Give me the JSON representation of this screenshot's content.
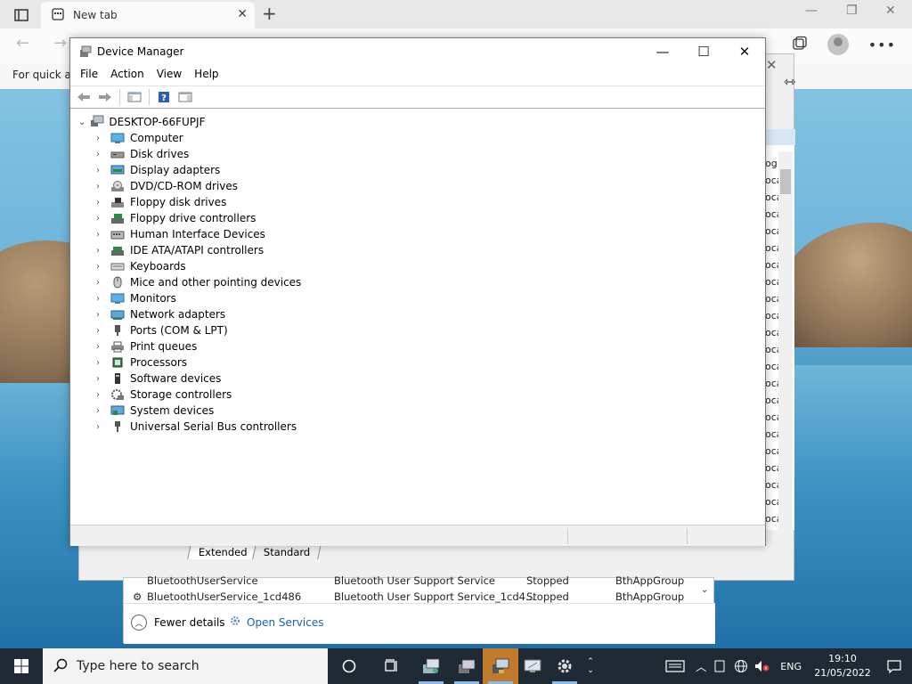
{
  "browser": {
    "tab_title": "New tab",
    "favorites_text": "For quick ac"
  },
  "services": {
    "column_items": [
      "og",
      "oca",
      "oca",
      "oca",
      "oca",
      "oca",
      "oca",
      "oca",
      "oca",
      "oca",
      "oca",
      "oca",
      "oca",
      "oca",
      "oca",
      "oca",
      "oca",
      "oca",
      "oca",
      "oca",
      "oca",
      "oca"
    ],
    "tabs": [
      "Extended",
      "Standard"
    ]
  },
  "task_manager": {
    "rows": [
      {
        "name": "BluetoothUserService",
        "description": "Bluetooth User Support Service",
        "status": "Stopped",
        "group": "BthAppGroup"
      },
      {
        "name": "BluetoothUserService_1cd486",
        "description": "Bluetooth User Support Service_1cd4...",
        "status": "Stopped",
        "group": "BthAppGroup"
      }
    ],
    "fewer_details": "Fewer details",
    "open_services": "Open Services"
  },
  "device_manager": {
    "title": "Device Manager",
    "menu": [
      "File",
      "Action",
      "View",
      "Help"
    ],
    "root": "DESKTOP-66FUPJF",
    "categories": [
      {
        "label": "Computer",
        "icon": "monitor-icon"
      },
      {
        "label": "Disk drives",
        "icon": "disk-drive-icon"
      },
      {
        "label": "Display adapters",
        "icon": "display-adapter-icon"
      },
      {
        "label": "DVD/CD-ROM drives",
        "icon": "dvd-icon"
      },
      {
        "label": "Floppy disk drives",
        "icon": "floppy-disk-icon"
      },
      {
        "label": "Floppy drive controllers",
        "icon": "floppy-controller-icon"
      },
      {
        "label": "Human Interface Devices",
        "icon": "hid-icon"
      },
      {
        "label": "IDE ATA/ATAPI controllers",
        "icon": "ide-controller-icon"
      },
      {
        "label": "Keyboards",
        "icon": "keyboard-icon"
      },
      {
        "label": "Mice and other pointing devices",
        "icon": "mouse-icon"
      },
      {
        "label": "Monitors",
        "icon": "monitor-icon"
      },
      {
        "label": "Network adapters",
        "icon": "network-adapter-icon"
      },
      {
        "label": "Ports (COM & LPT)",
        "icon": "port-icon"
      },
      {
        "label": "Print queues",
        "icon": "printer-icon"
      },
      {
        "label": "Processors",
        "icon": "processor-icon"
      },
      {
        "label": "Software devices",
        "icon": "software-device-icon"
      },
      {
        "label": "Storage controllers",
        "icon": "storage-controller-icon"
      },
      {
        "label": "System devices",
        "icon": "system-device-icon"
      },
      {
        "label": "Universal Serial Bus controllers",
        "icon": "usb-icon"
      }
    ]
  },
  "taskbar": {
    "search_placeholder": "Type here to search",
    "language": "ENG",
    "time": "19:10",
    "date": "21/05/2022"
  }
}
